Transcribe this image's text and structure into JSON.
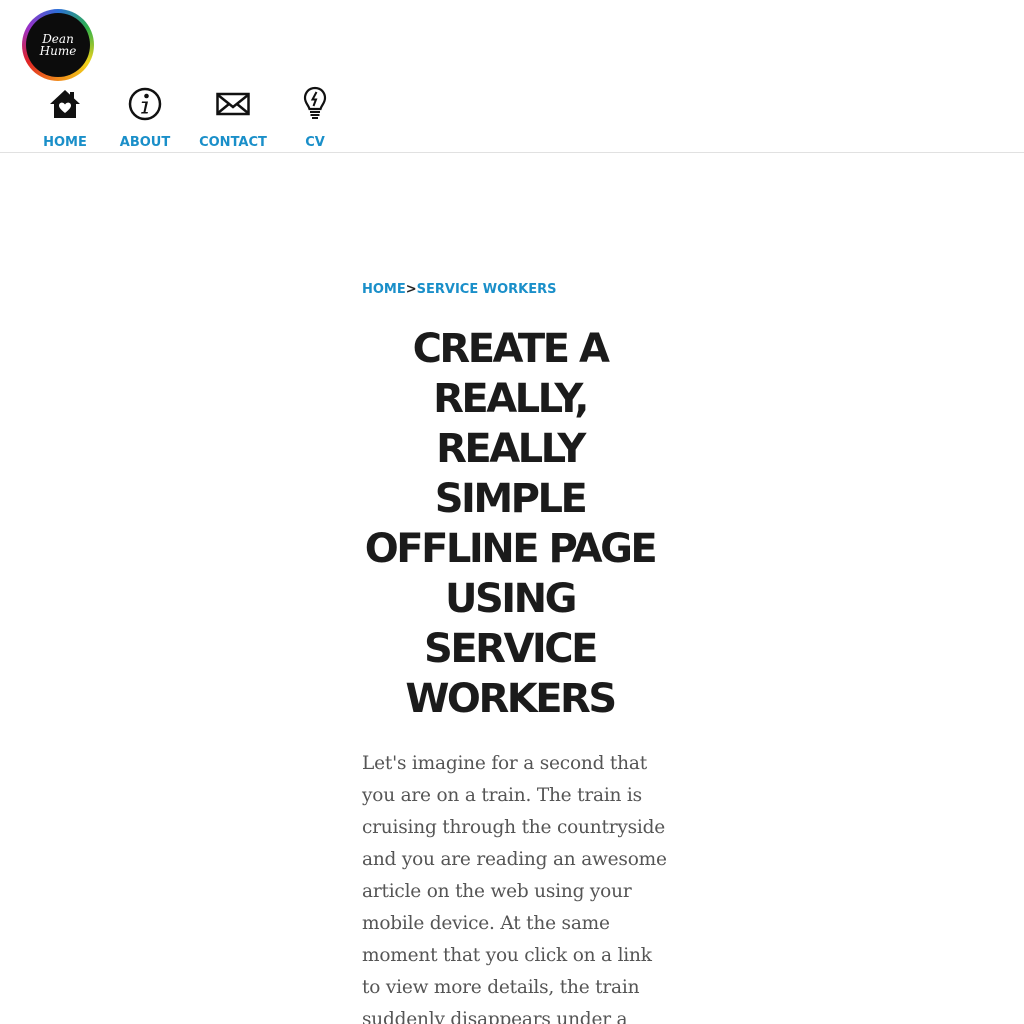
{
  "header": {
    "logo": {
      "line1": "Dean",
      "line2": "Hume"
    },
    "nav": [
      {
        "label": "HOME",
        "icon": "house-heart-icon"
      },
      {
        "label": "ABOUT",
        "icon": "info-icon"
      },
      {
        "label": "CONTACT",
        "icon": "envelope-icon"
      },
      {
        "label": "CV",
        "icon": "lightbulb-icon"
      }
    ]
  },
  "breadcrumb": {
    "home": "HOME",
    "separator": ">",
    "current": "SERVICE WORKERS"
  },
  "article": {
    "title_lines": [
      "CREATE A",
      "REALLY,",
      "REALLY",
      "SIMPLE",
      "OFFLINE PAGE",
      "USING",
      "SERVICE",
      "WORKERS"
    ],
    "intro_lines": [
      "Let's imagine for a second that",
      "you are on a train. The train is",
      "cruising through the countryside",
      "and you are reading an awesome",
      "article on the web using your",
      "mobile device. At the same",
      "moment that you click on a link",
      "to view more details, the train",
      "suddenly disappears under a"
    ]
  },
  "colors": {
    "link": "#1a8fc9",
    "title": "#1b1b1b",
    "body_text": "#555555",
    "divider": "#e1e1e1"
  }
}
